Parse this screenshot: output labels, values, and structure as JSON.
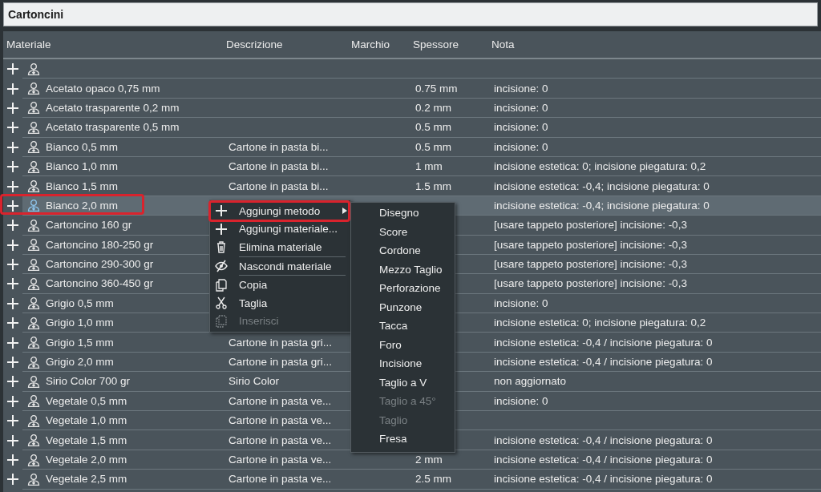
{
  "window": {
    "title": "Cartoncini"
  },
  "table": {
    "columns": [
      "Materiale",
      "Descrizione",
      "Marchio",
      "Spessore",
      "Nota"
    ],
    "rows": [
      {
        "materiale": "",
        "selected": false,
        "highlighted": false
      },
      {
        "materiale": "Acetato opaco 0,75 mm",
        "spessore": "0.75 mm",
        "nota": "incisione: 0",
        "selected": false,
        "highlighted": false
      },
      {
        "materiale": "Acetato trasparente 0,2 mm",
        "spessore": "0.2 mm",
        "nota": "incisione: 0",
        "selected": false,
        "highlighted": false
      },
      {
        "materiale": "Acetato trasparente 0,5 mm",
        "spessore": "0.5 mm",
        "nota": "incisione: 0",
        "selected": false,
        "highlighted": false
      },
      {
        "materiale": "Bianco 0,5 mm",
        "descrizione": "Cartone in pasta bi...",
        "spessore": "0.5 mm",
        "nota": "incisione: 0",
        "selected": false,
        "highlighted": false
      },
      {
        "materiale": "Bianco 1,0 mm",
        "descrizione": "Cartone in pasta bi...",
        "spessore": "1 mm",
        "nota": "incisione estetica: 0; incisione piegatura: 0,2",
        "selected": false,
        "highlighted": false
      },
      {
        "materiale": "Bianco 1,5 mm",
        "descrizione": "Cartone in pasta bi...",
        "spessore": "1.5 mm",
        "nota": "incisione estetica: -0,4; incisione piegatura: 0",
        "selected": false,
        "highlighted": false
      },
      {
        "materiale": "Bianco 2,0 mm",
        "nota": "incisione estetica: -0,4; incisione piegatura: 0",
        "selected": true,
        "highlighted": true
      },
      {
        "materiale": "Cartoncino 160 gr",
        "nota": "[usare tappeto posteriore] incisione: -0,3",
        "selected": false,
        "highlighted": false
      },
      {
        "materiale": "Cartoncino 180-250 gr",
        "nota": "[usare tappeto posteriore] incisione: -0,3",
        "selected": false,
        "highlighted": false
      },
      {
        "materiale": "Cartoncino 290-300 gr",
        "nota": "[usare tappeto posteriore] incisione: -0,3",
        "selected": false,
        "highlighted": false
      },
      {
        "materiale": "Cartoncino 360-450 gr",
        "nota": "[usare tappeto posteriore] incisione: -0,3",
        "selected": false,
        "highlighted": false
      },
      {
        "materiale": "Grigio 0,5 mm",
        "nota": "incisione: 0",
        "selected": false,
        "highlighted": false
      },
      {
        "materiale": "Grigio 1,0 mm",
        "nota": "incisione estetica: 0; incisione piegatura: 0,2",
        "selected": false,
        "highlighted": false
      },
      {
        "materiale": "Grigio 1,5 mm",
        "descrizione": "Cartone in pasta gri...",
        "nota": "incisione estetica: -0,4 / incisione piegatura: 0",
        "selected": false,
        "highlighted": false
      },
      {
        "materiale": "Grigio 2,0 mm",
        "descrizione": "Cartone in pasta gri...",
        "nota": "incisione estetica: -0,4 / incisione piegatura: 0",
        "selected": false,
        "highlighted": false
      },
      {
        "materiale": "Sirio Color 700 gr",
        "descrizione": "Sirio Color",
        "nota": "non aggiornato",
        "selected": false,
        "highlighted": false
      },
      {
        "materiale": "Vegetale 0,5 mm",
        "descrizione": "Cartone in pasta ve...",
        "nota": "incisione: 0",
        "selected": false,
        "highlighted": false
      },
      {
        "materiale": "Vegetale 1,0 mm",
        "descrizione": "Cartone in pasta ve...",
        "selected": false,
        "highlighted": false
      },
      {
        "materiale": "Vegetale 1,5 mm",
        "descrizione": "Cartone in pasta ve...",
        "nota": "incisione estetica: -0,4 / incisione piegatura: 0",
        "selected": false,
        "highlighted": false
      },
      {
        "materiale": "Vegetale 2,0 mm",
        "descrizione": "Cartone in pasta ve...",
        "spessore": "2 mm",
        "nota": "incisione estetica: -0,4 / incisione piegatura: 0",
        "selected": false,
        "highlighted": false
      },
      {
        "materiale": "Vegetale 2,5 mm",
        "descrizione": "Cartone in pasta ve...",
        "spessore": "2.5 mm",
        "nota": "incisione estetica: -0,4 / incisione piegatura: 0",
        "selected": false,
        "highlighted": false
      }
    ]
  },
  "context_menu": {
    "items": [
      {
        "kind": "item",
        "label": "Aggiungi metodo",
        "has_submenu": true,
        "highlighted": true,
        "disabled": false
      },
      {
        "kind": "item",
        "label": "Aggiungi materiale...",
        "highlighted": false,
        "disabled": false
      },
      {
        "kind": "item",
        "label": "Elimina materiale",
        "highlighted": false,
        "disabled": false
      },
      {
        "kind": "separator"
      },
      {
        "kind": "item",
        "label": "Nascondi materiale",
        "highlighted": false,
        "disabled": false
      },
      {
        "kind": "separator"
      },
      {
        "kind": "item",
        "label": "Copia",
        "highlighted": false,
        "disabled": false
      },
      {
        "kind": "item",
        "label": "Taglia",
        "highlighted": false,
        "disabled": false
      },
      {
        "kind": "item",
        "label": "Inserisci",
        "highlighted": false,
        "disabled": true
      }
    ]
  },
  "submenu": {
    "items": [
      {
        "label": "Disegno",
        "disabled": false
      },
      {
        "label": "Score",
        "disabled": false
      },
      {
        "label": "Cordone",
        "disabled": false
      },
      {
        "label": "Mezzo Taglio",
        "disabled": false
      },
      {
        "label": "Perforazione",
        "disabled": false
      },
      {
        "label": "Punzone",
        "disabled": false
      },
      {
        "label": "Tacca",
        "disabled": false
      },
      {
        "label": "Foro",
        "disabled": false
      },
      {
        "label": "Incisione",
        "disabled": false
      },
      {
        "label": "Taglio a V",
        "disabled": false
      },
      {
        "label": "Taglio a 45°",
        "disabled": true
      },
      {
        "label": "Taglio",
        "disabled": true
      },
      {
        "label": "Fresa",
        "disabled": false
      }
    ]
  }
}
